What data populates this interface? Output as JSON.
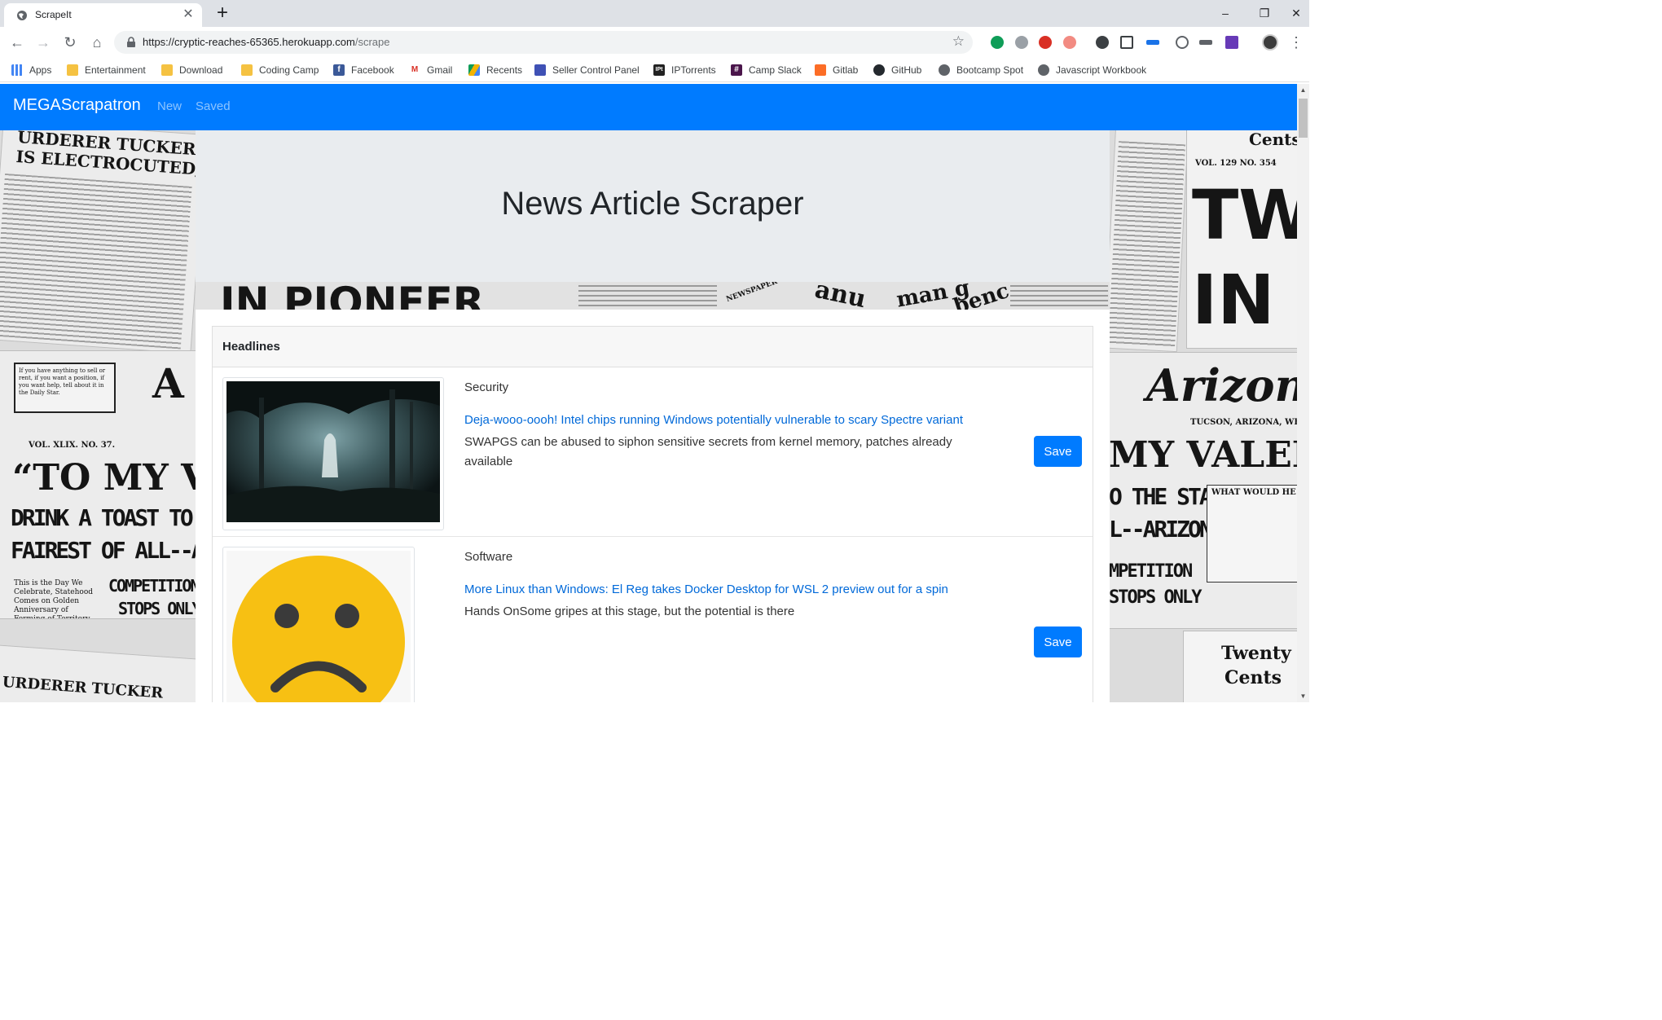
{
  "browser": {
    "tab_title": "ScrapeIt",
    "url_host": "https://cryptic-reaches-65365.herokuapp.com",
    "url_path": "/scrape",
    "bookmarks": [
      {
        "label": "Apps",
        "icon": "apps-grid-icon"
      },
      {
        "label": "Entertainment",
        "icon": "folder-icon"
      },
      {
        "label": "Download",
        "icon": "folder-icon"
      },
      {
        "label": "Coding Camp",
        "icon": "folder-icon"
      },
      {
        "label": "Facebook",
        "icon": "facebook-icon"
      },
      {
        "label": "Gmail",
        "icon": "gmail-icon"
      },
      {
        "label": "Recents",
        "icon": "drive-icon"
      },
      {
        "label": "Seller Control Panel",
        "icon": "seller-icon"
      },
      {
        "label": "IPTorrents",
        "icon": "ipt-icon"
      },
      {
        "label": "Camp Slack",
        "icon": "slack-icon"
      },
      {
        "label": "Gitlab",
        "icon": "gitlab-icon"
      },
      {
        "label": "GitHub",
        "icon": "github-icon"
      },
      {
        "label": "Bootcamp Spot",
        "icon": "globe-icon"
      },
      {
        "label": "Javascript Workbook",
        "icon": "globe-icon"
      }
    ]
  },
  "navbar": {
    "brand": "MEGAScrapatron",
    "links": [
      "New",
      "Saved"
    ],
    "color": "#007bff"
  },
  "jumbotron": {
    "title": "News Article Scraper"
  },
  "newspaper_left": {
    "headline1": "URDERER TUCKER",
    "headline2": "IS ELECTROCUTED,",
    "headline3": "“TO MY V",
    "headline4": "DRINK A TOAST TO THE STAT",
    "headline5": "FAIREST OF ALL--ARIZON",
    "headline6": "COMPETITION",
    "headline7": "STOPS ONLY",
    "vol": "VOL. XLIX.   NO. 37.",
    "fine": "If you have anything to sell or rent, if you want a position, if you want help, tell about it in the Daily Star.",
    "small": "This is the Day We Celebrate, Statehood Comes on Golden Anniversary of Forming of Territory, Governor-elect at Capital",
    "bottom": "URDERER TUCKER"
  },
  "newspaper_strip": {
    "big": "IN PIONEER",
    "bits": [
      "NEWSPAPER",
      "anu",
      "man g",
      "benc"
    ]
  },
  "newspaper_right": {
    "cents_top": "Cents",
    "vol": "VOL. 129     NO. 354",
    "tw": "TW",
    "in": "IN",
    "arizona": "Arizona",
    "tucson": "TUCSON, ARIZONA, WE",
    "valen": "MY VALEN",
    "state": "O THE STATE",
    "arizona2": "L--ARIZONA",
    "what": "WHAT WOULD HE",
    "competition": "MPETITION",
    "stops": "STOPS ONLY",
    "twenty": "Twenty",
    "cents_bottom": "Cents"
  },
  "card": {
    "header": "Headlines",
    "articles": [
      {
        "category": "Security",
        "title": "Deja-wooo-oooh! Intel chips running Windows potentially vulnerable to scary Spectre variant",
        "summary": "SWAPGS can be abused to siphon sensitive secrets from kernel memory, patches already available",
        "save_label": "Save",
        "image": "ghost-in-forest-image"
      },
      {
        "category": "Software",
        "title": "More Linux than Windows: El Reg takes Docker Desktop for WSL 2 preview out for a spin",
        "summary": "Hands OnSome gripes at this stage, but the potential is there",
        "save_label": "Save",
        "image": "sad-face-image"
      }
    ]
  }
}
